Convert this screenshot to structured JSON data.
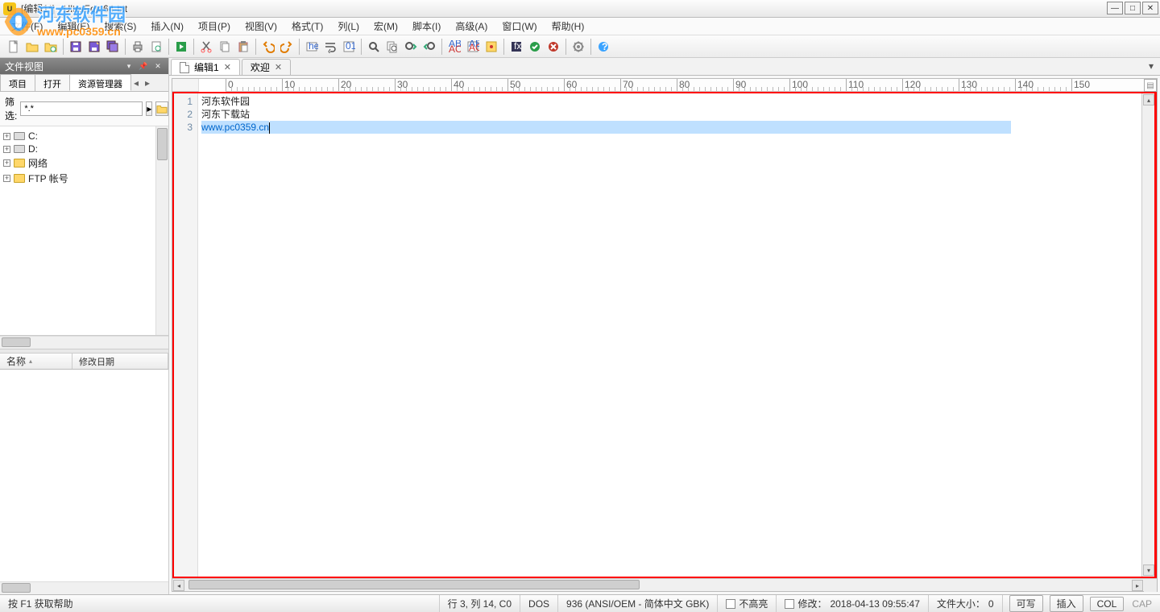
{
  "window": {
    "title": "[编辑1*] - UltraEdit 64-bit"
  },
  "watermark": {
    "text": "河东软件园",
    "url": "www.pc0359.cn"
  },
  "menu": {
    "items": [
      "文件(F)",
      "编辑(E)",
      "搜索(S)",
      "插入(N)",
      "项目(P)",
      "视图(V)",
      "格式(T)",
      "列(L)",
      "宏(M)",
      "脚本(I)",
      "高级(A)",
      "窗口(W)",
      "帮助(H)"
    ]
  },
  "sidebar": {
    "title": "文件视图",
    "tabs": [
      "项目",
      "打开",
      "资源管理器"
    ],
    "active_tab_index": 2,
    "filter_label": "筛选:",
    "filter_value": "*.*",
    "tree": [
      {
        "label": "C:",
        "kind": "drive"
      },
      {
        "label": "D:",
        "kind": "drive"
      },
      {
        "label": "网络",
        "kind": "folder"
      },
      {
        "label": "FTP 帐号",
        "kind": "folder"
      }
    ],
    "list_columns": [
      "名称",
      "修改日期"
    ]
  },
  "tabs": [
    {
      "label": "编辑1",
      "active": true
    },
    {
      "label": "欢迎",
      "active": false
    }
  ],
  "editor": {
    "lines": [
      {
        "n": 1,
        "text": "河东软件园",
        "selected": false
      },
      {
        "n": 2,
        "text": "河东下载站",
        "selected": false
      },
      {
        "n": 3,
        "text": "www.pc0359.cn",
        "selected": true,
        "link": true
      }
    ]
  },
  "status": {
    "help": "按 F1 获取帮助",
    "pos": "行 3, 列 14, C0",
    "eol": "DOS",
    "encoding": "936  (ANSI/OEM - 简体中文 GBK)",
    "highlight": "不高亮",
    "modified_label": "修改：",
    "modified_time": "2018-04-13 09:55:47",
    "size_label": "文件大小：",
    "size_value": "0",
    "btn_rw": "可写",
    "btn_ins": "插入",
    "btn_col": "COL",
    "cap": "CAP"
  }
}
